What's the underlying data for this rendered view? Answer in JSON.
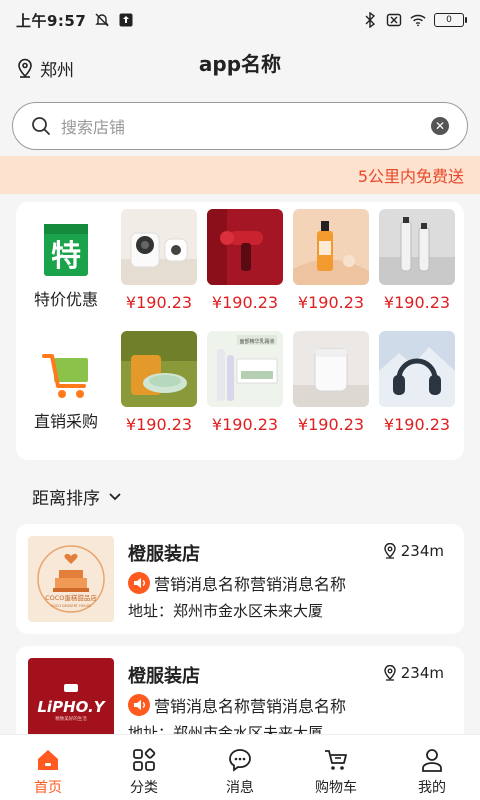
{
  "status_bar": {
    "time": "上午9:57",
    "battery": "0"
  },
  "header": {
    "location": "郑州",
    "title": "app名称"
  },
  "search": {
    "placeholder": "搜索店铺"
  },
  "promo": {
    "text": "5公里内免费送"
  },
  "deals": [
    {
      "category": "特价优惠",
      "icon": "special-offer-icon",
      "products": [
        {
          "price": "¥190.23",
          "image": "smart-camera-product"
        },
        {
          "price": "¥190.23",
          "image": "massage-gun-product"
        },
        {
          "price": "¥190.23",
          "image": "serum-bottle-product"
        },
        {
          "price": "¥190.23",
          "image": "tube-cosmetics-product"
        }
      ]
    },
    {
      "category": "直销采购",
      "icon": "shopping-cart-icon",
      "products": [
        {
          "price": "¥190.23",
          "image": "green-device-product"
        },
        {
          "price": "¥190.23",
          "image": "skincare-set-product"
        },
        {
          "price": "¥190.23",
          "image": "humidifier-product"
        },
        {
          "price": "¥190.23",
          "image": "headphones-product"
        }
      ]
    }
  ],
  "sort": {
    "label": "距离排序"
  },
  "shops": [
    {
      "name": "橙服装店",
      "distance": "234m",
      "message": "营销消息名称营销消息名称",
      "address": "地址：郑州市金水区未来大厦",
      "logo_text": "COCO蛋糕甜品店",
      "logo_sub": "COCO DESSERT HOUSE"
    },
    {
      "name": "橙服装店",
      "distance": "234m",
      "message": "营销消息名称营销消息名称",
      "address": "地址：郑州市金水区未来大厦",
      "logo_text": "LiPHO.Y",
      "logo_sub": "精致美好的生活"
    }
  ],
  "tabs": [
    {
      "label": "首页",
      "icon": "home-icon",
      "active": true
    },
    {
      "label": "分类",
      "icon": "category-icon",
      "active": false
    },
    {
      "label": "消息",
      "icon": "message-icon",
      "active": false
    },
    {
      "label": "购物车",
      "icon": "cart-icon",
      "active": false
    },
    {
      "label": "我的",
      "icon": "profile-icon",
      "active": false
    }
  ],
  "colors": {
    "accent": "#ff5a1f",
    "price": "#e02020",
    "promo_bg": "#fde3cf",
    "promo_text": "#e8492a",
    "special_green": "#1aa34a"
  }
}
